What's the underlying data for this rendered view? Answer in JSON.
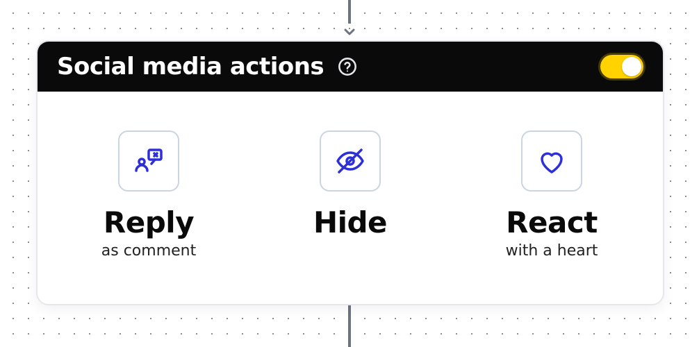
{
  "header": {
    "title": "Social media actions"
  },
  "toggle": {
    "on": true
  },
  "actions": [
    {
      "icon": "reply",
      "title": "Reply",
      "subtitle": "as comment"
    },
    {
      "icon": "hide",
      "title": "Hide",
      "subtitle": ""
    },
    {
      "icon": "react",
      "title": "React",
      "subtitle": "with a heart"
    }
  ]
}
